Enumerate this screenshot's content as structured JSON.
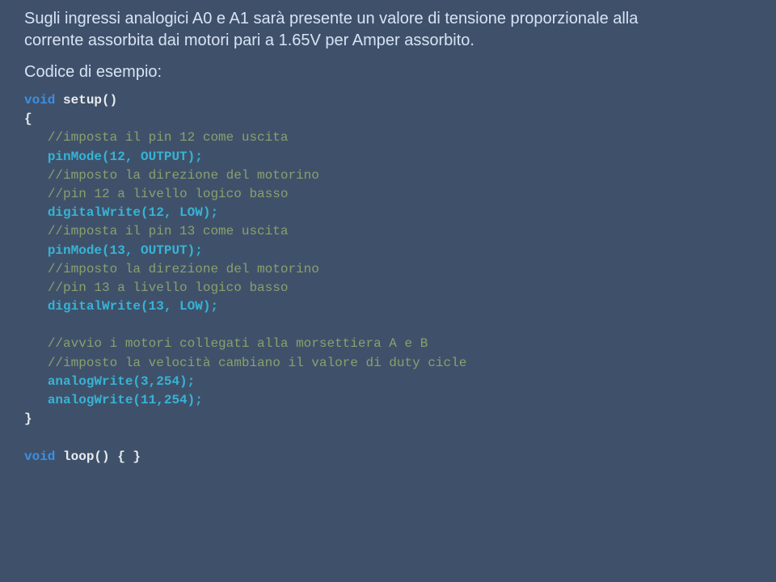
{
  "intro": {
    "line1": "Sugli ingressi analogici A0 e A1 sarà presente un valore di tensione proporzionale alla",
    "line2": "corrente assorbita dai motori pari a 1.65V per Amper assorbito."
  },
  "label": "Codice di esempio:",
  "code": {
    "void": "void",
    "setup_decl": " setup()",
    "brace_open": "{",
    "c_pin12_a": "//imposta il pin 12 come uscita",
    "pinmode12": "pinMode(12, OUTPUT);",
    "c_dir12_a": "//imposto la direzione del motorino",
    "c_dir12_b": "//pin 12 a livello logico basso",
    "dw12": "digitalWrite(12, LOW);",
    "c_pin13_a": "//imposta il pin 13 come uscita",
    "pinmode13": "pinMode(13, OUTPUT);",
    "c_dir13_a": "//imposto la direzione del motorino",
    "c_dir13_b": "//pin 13 a livello logico basso",
    "dw13": "digitalWrite(13, LOW);",
    "c_avvio_a": "//avvio i motori collegati alla morsettiera A e B",
    "c_avvio_b": "//imposto la velocità cambiano il valore di duty cicle",
    "aw3": "analogWrite(3,254);",
    "aw11": "analogWrite(11,254);",
    "brace_close": "}",
    "loop_rest": " loop() { }"
  }
}
